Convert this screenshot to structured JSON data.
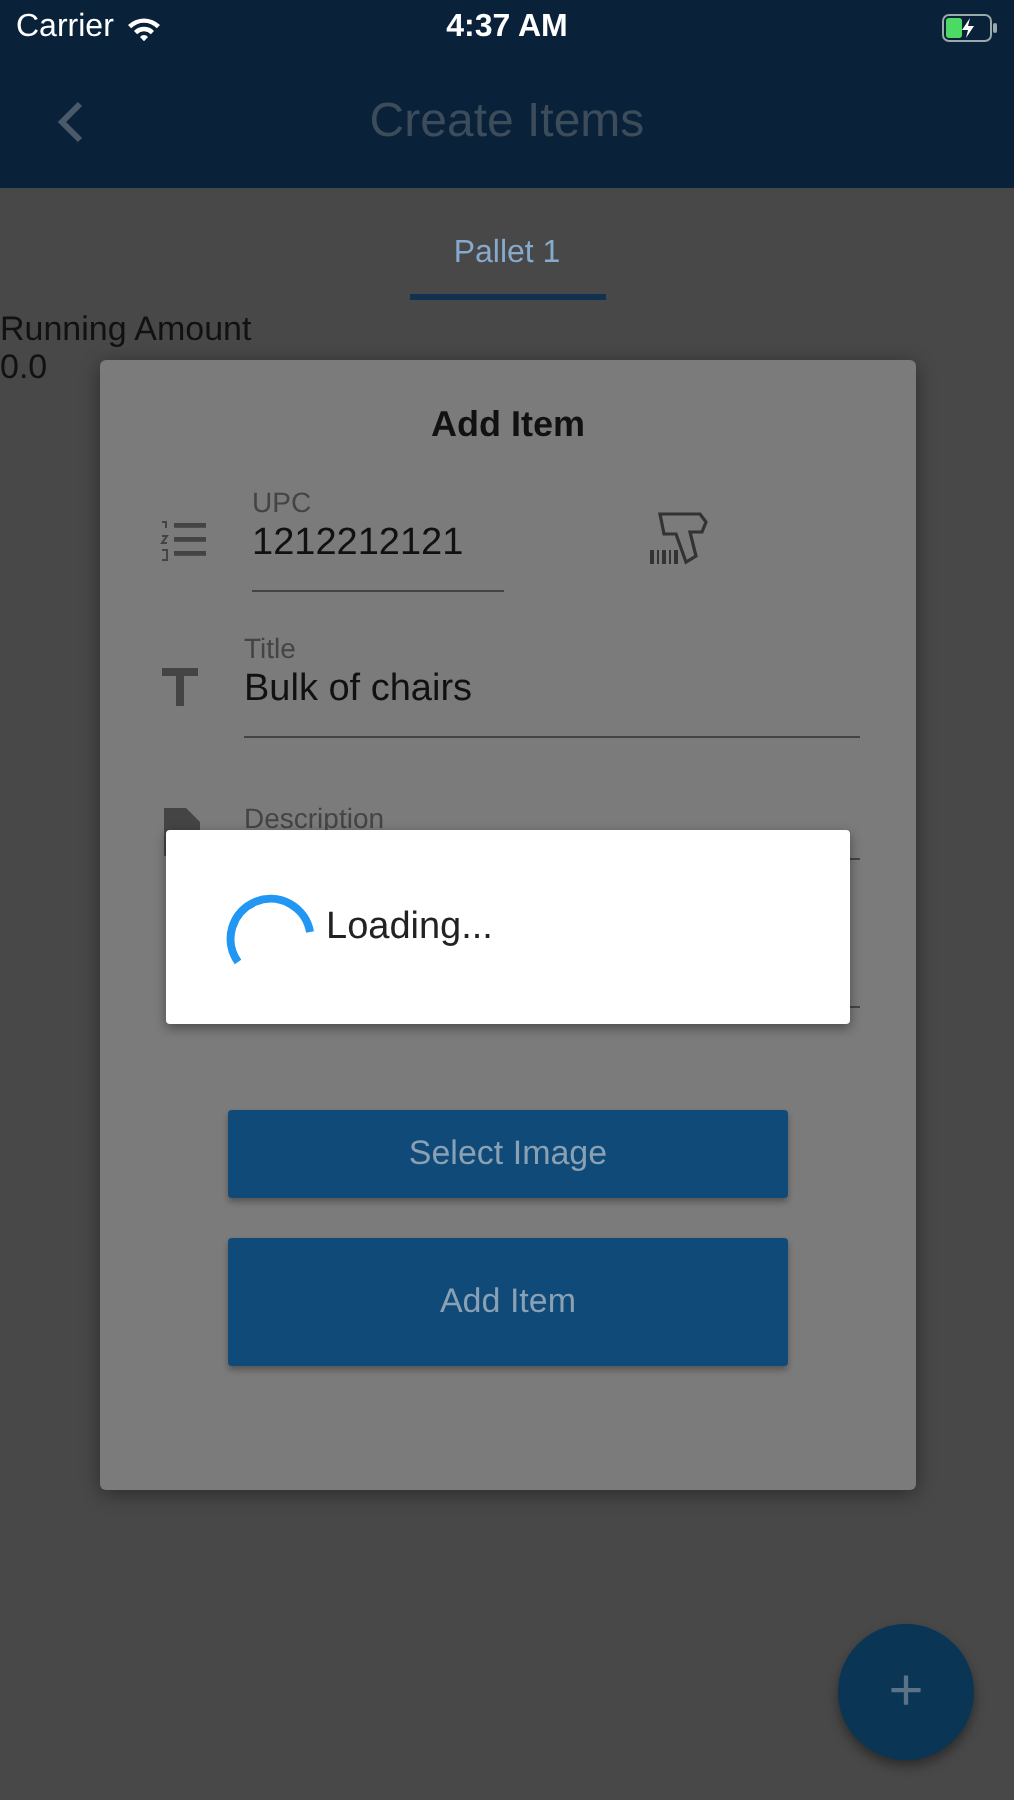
{
  "status_bar": {
    "carrier": "Carrier",
    "time": "4:37 AM"
  },
  "nav_bar": {
    "title": "Create Items"
  },
  "tabs": [
    {
      "label": "Pallet 1",
      "selected": true
    }
  ],
  "running_amount": {
    "label": "Running Amount",
    "value": "0.0"
  },
  "dialog": {
    "title": "Add Item",
    "fields": [
      {
        "kind": "upc",
        "label": "UPC",
        "value": "1212212121"
      },
      {
        "kind": "title",
        "label": "Title",
        "value": "Bulk of chairs"
      },
      {
        "kind": "description",
        "label": "Description"
      }
    ],
    "buttons": [
      {
        "label": "Select Image",
        "kind": "short"
      },
      {
        "label": "Add Item",
        "kind": "tall"
      }
    ]
  },
  "loading": {
    "text": "Loading..."
  },
  "fab": {
    "text": "+"
  }
}
